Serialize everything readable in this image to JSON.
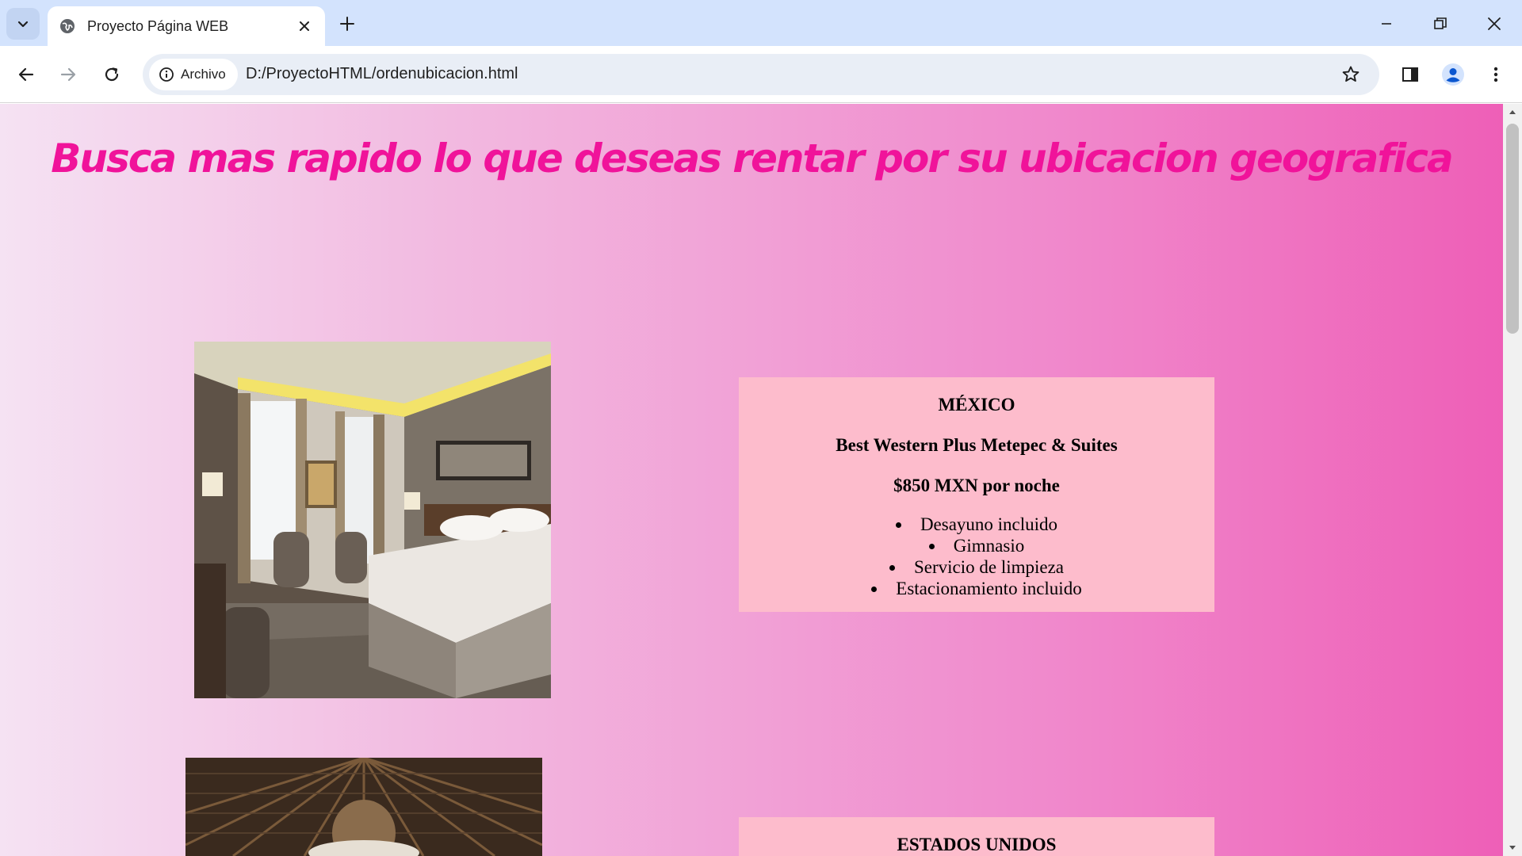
{
  "browser": {
    "tab_title": "Proyecto Página WEB",
    "site_chip_label": "Archivo",
    "url": "D:/ProyectoHTML/ordenubicacion.html",
    "icons": {
      "tab_search": "chevron-down-icon",
      "favicon": "globe-icon",
      "tab_close": "close-icon",
      "new_tab": "plus-icon",
      "minimize": "minimize-icon",
      "restore": "restore-icon",
      "close_window": "close-icon",
      "back": "arrow-left-icon",
      "forward": "arrow-right-icon",
      "reload": "reload-icon",
      "site_info": "info-icon",
      "bookmark": "star-icon",
      "side_panel": "side-panel-icon",
      "profile": "person-icon",
      "menu": "kebab-menu-icon"
    }
  },
  "page": {
    "heading": "Busca mas rapido lo que deseas rentar por su ubicacion geografica",
    "colors": {
      "heading": "#f0139a",
      "card_background": "#fdbccc",
      "gradient_start": "#f5e2f3",
      "gradient_end": "#ee5fb7"
    },
    "listings": [
      {
        "country": "MÉXICO",
        "hotel": "Best Western Plus Metepec & Suites",
        "price": "$850 MXN por noche",
        "amenities": [
          "Desayuno incluido",
          "Gimnasio",
          "Servicio de limpieza",
          "Estacionamiento incluido"
        ],
        "image": "hotel-room-photo"
      },
      {
        "country": "ESTADOS UNIDOS",
        "image": "palapa-roof-photo"
      }
    ]
  }
}
